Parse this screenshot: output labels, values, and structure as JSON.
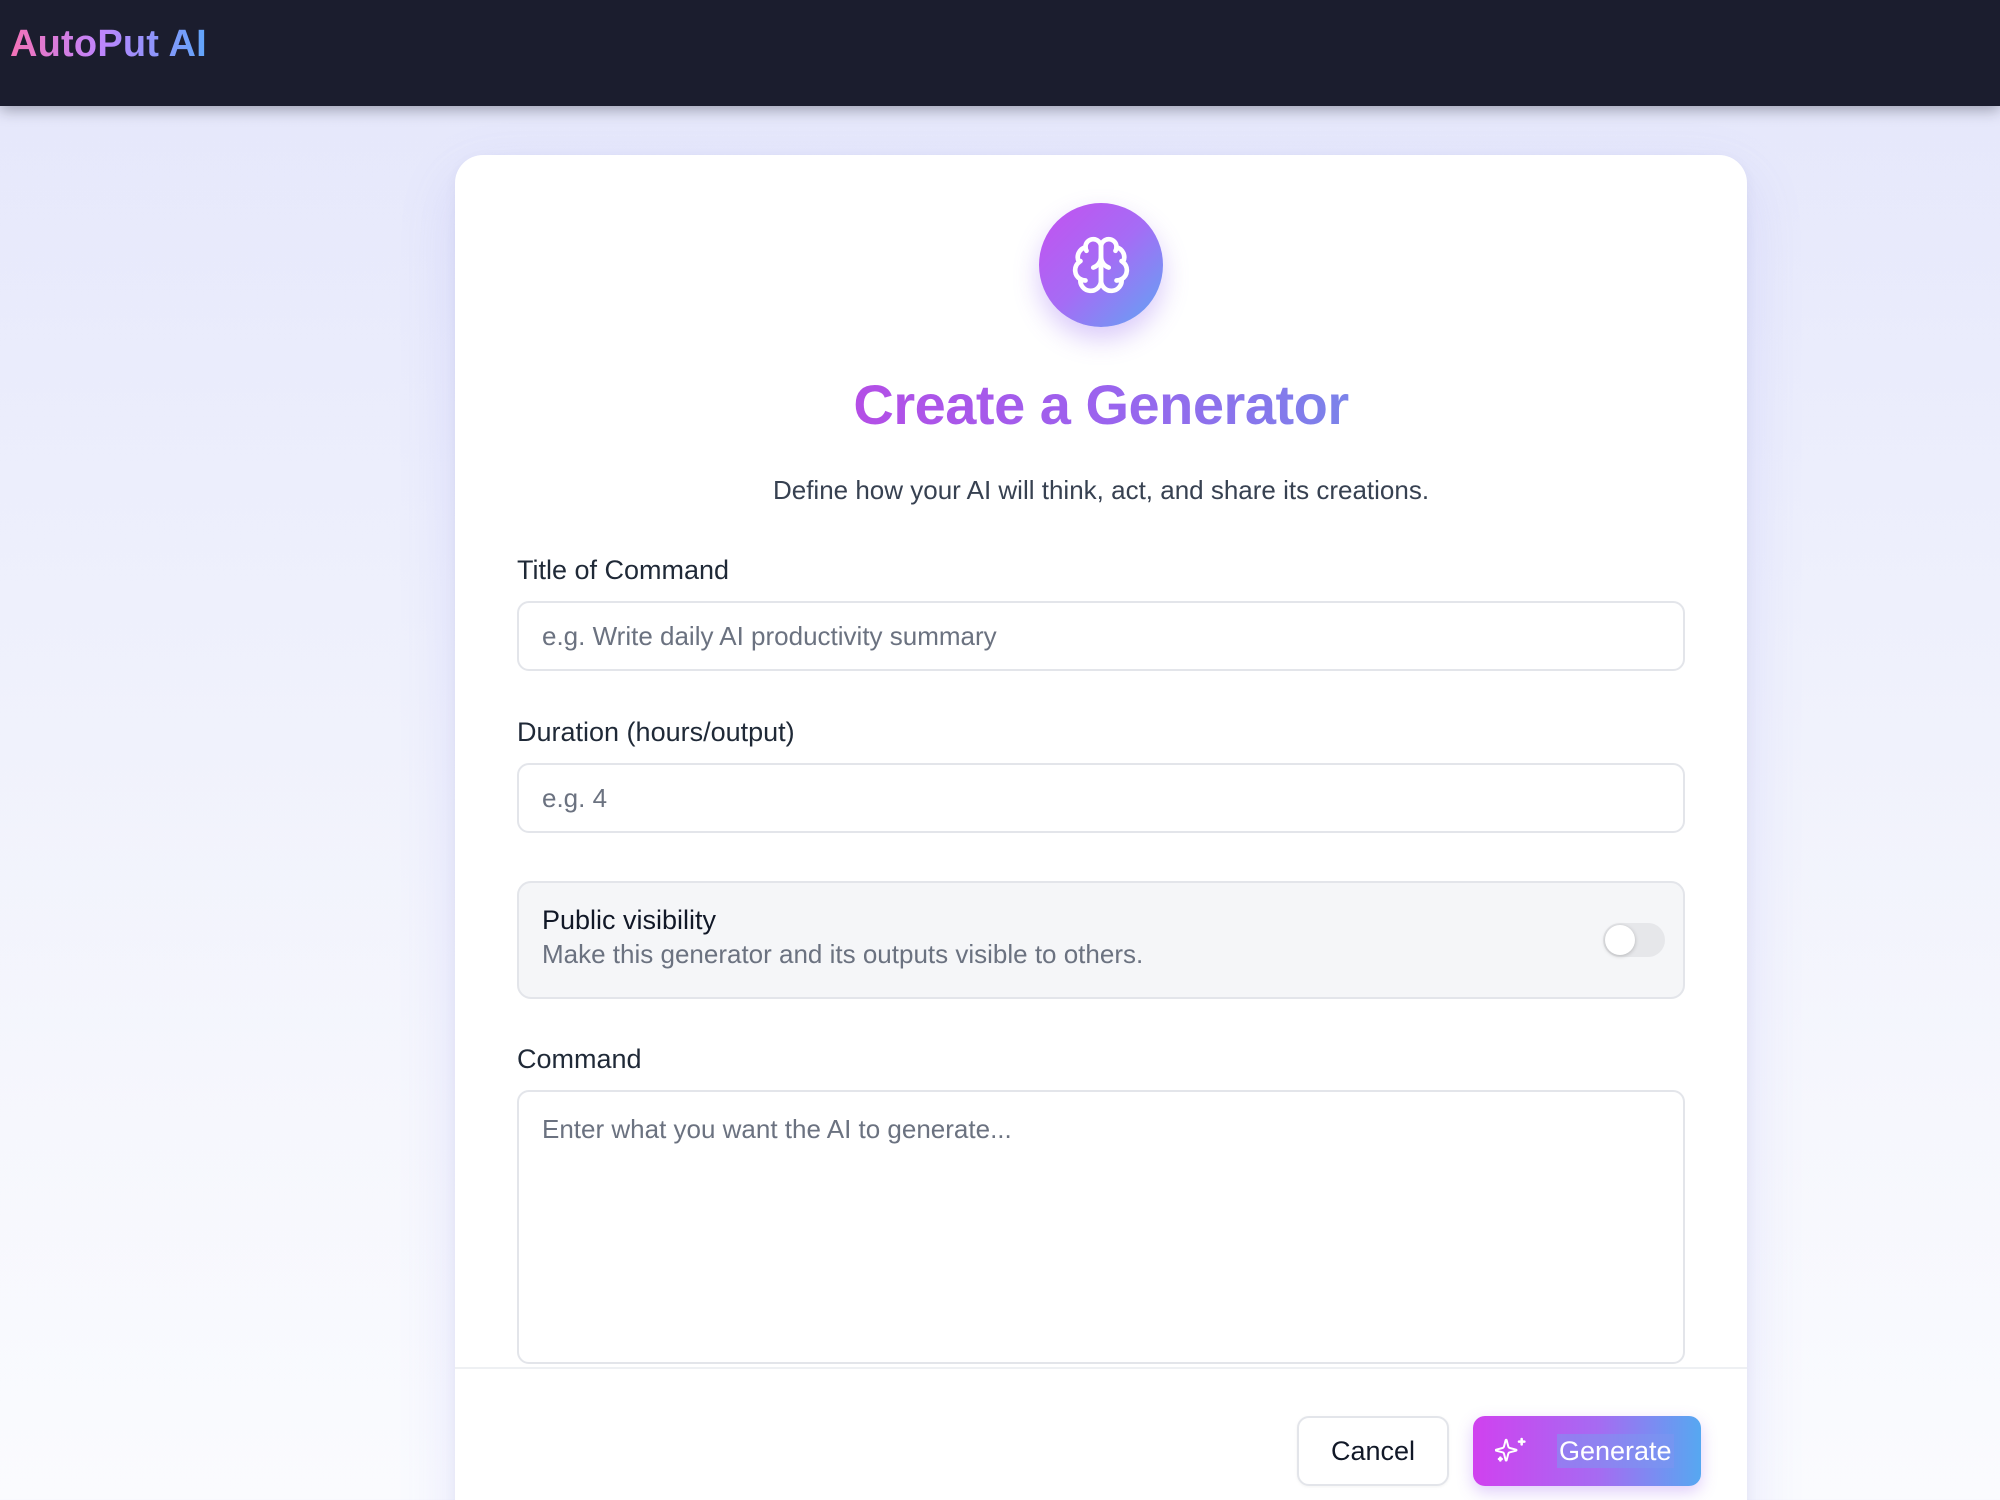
{
  "header": {
    "brand": "AutoPut AI"
  },
  "form": {
    "icon": "brain-icon",
    "title": "Create a Generator",
    "subtitle": "Define how your AI will think, act, and share its creations.",
    "title_field": {
      "label": "Title of Command",
      "placeholder": "e.g. Write daily AI productivity summary",
      "value": ""
    },
    "duration_field": {
      "label": "Duration (hours/output)",
      "placeholder": "e.g. 4",
      "value": ""
    },
    "visibility": {
      "title": "Public visibility",
      "description": "Make this generator and its outputs visible to others.",
      "enabled": false
    },
    "command_field": {
      "label": "Command",
      "placeholder": "Enter what you want the AI to generate...",
      "value": ""
    }
  },
  "actions": {
    "cancel_label": "Cancel",
    "generate_label": "Generate",
    "generate_icon": "sparkles-icon"
  },
  "colors": {
    "topbar": "#1b1d2e",
    "accent_start": "#d041ef",
    "accent_end": "#56a8f1"
  }
}
